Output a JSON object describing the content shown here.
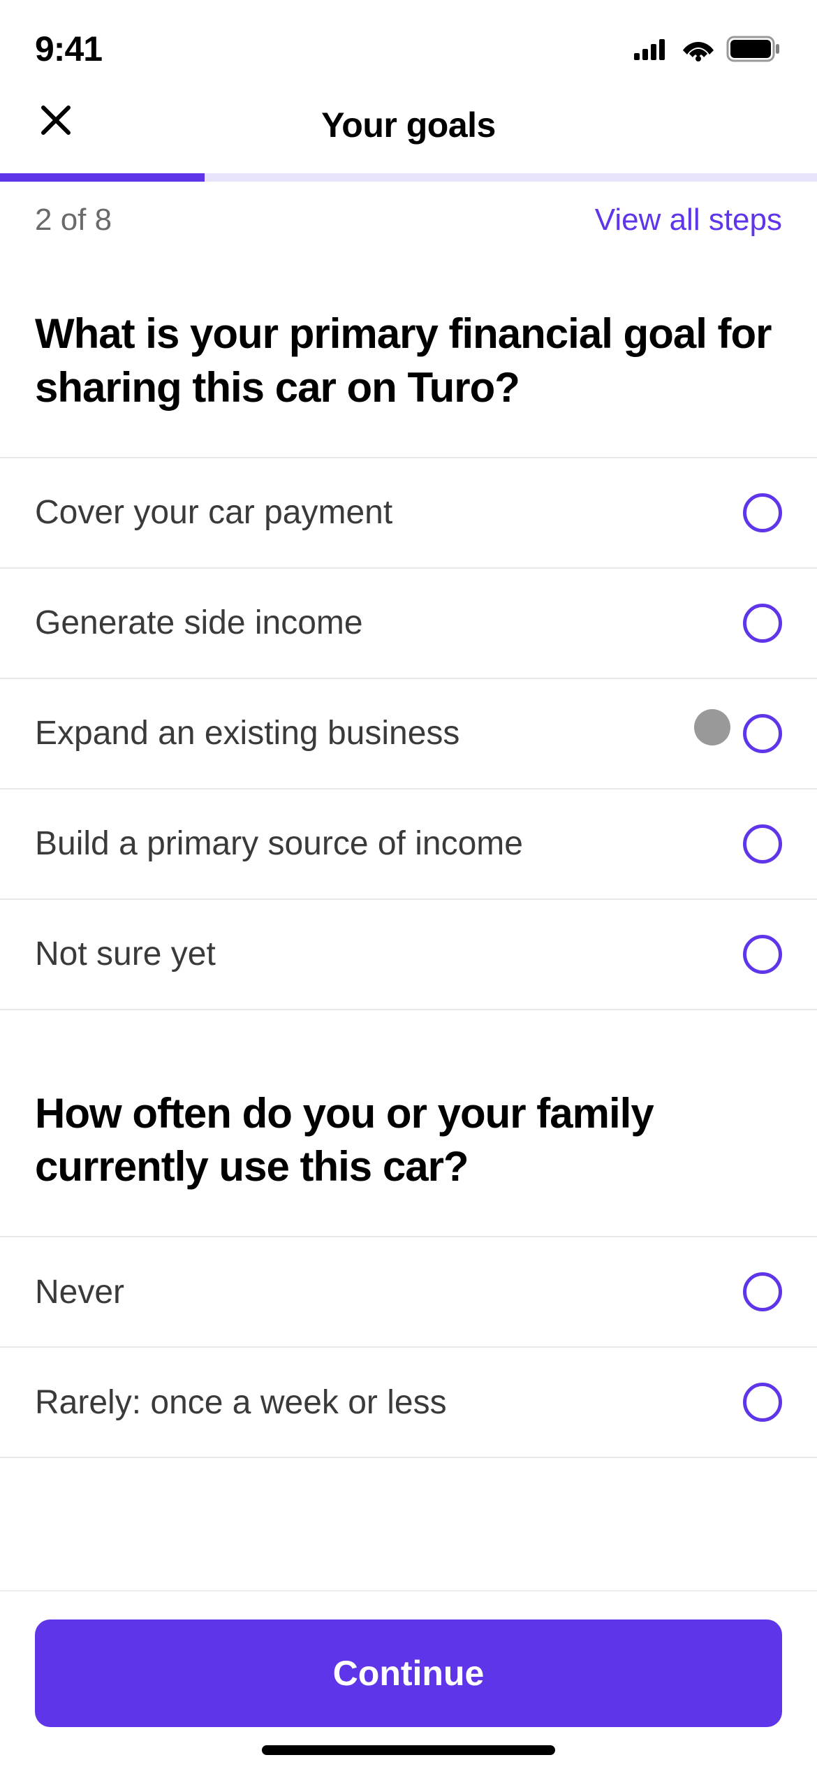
{
  "status": {
    "time": "9:41"
  },
  "nav": {
    "title": "Your goals"
  },
  "steps": {
    "count_label": "2 of 8",
    "view_all_label": "View all steps"
  },
  "q1": {
    "text": "What is your primary financial goal for sharing this car on Turo?",
    "options": [
      "Cover your car payment",
      "Generate side income",
      "Expand an existing business",
      "Build a primary source of income",
      "Not sure yet"
    ]
  },
  "q2": {
    "text": "How often do you or your family currently use this car?",
    "options": [
      "Never",
      "Rarely: once a week or less"
    ]
  },
  "footer": {
    "continue_label": "Continue"
  }
}
